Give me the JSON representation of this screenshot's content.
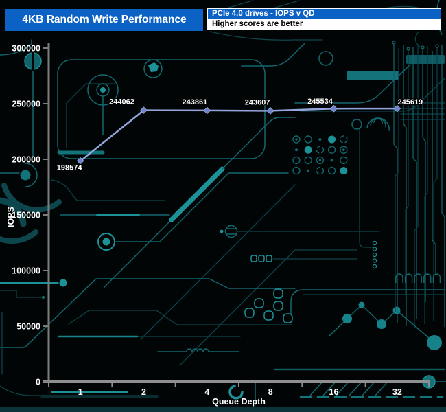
{
  "header": {
    "title": "4KB Random Write Performance",
    "subtitle": "PCIe 4.0 drives - IOPS v QD",
    "note": "Higher scores are better",
    "accent_color": "#0b61c4"
  },
  "chart_data": {
    "type": "line",
    "title": "4KB Random Write Performance",
    "categories": [
      "1",
      "2",
      "4",
      "8",
      "16",
      "32"
    ],
    "series": [
      {
        "name": "PCIe 4.0 drive",
        "values": [
          198574,
          244062,
          243861,
          243607,
          245534,
          245619
        ]
      }
    ],
    "point_labels": [
      "198574",
      "244062",
      "243861",
      "243607",
      "245534",
      "245619"
    ],
    "xlabel": "Queue Depth",
    "ylabel": "IOPS",
    "ylim": [
      0,
      300000
    ],
    "ytick_step": 50000,
    "yticks": [
      "300000",
      "250000",
      "200000",
      "150000",
      "100000",
      "50000",
      "0"
    ],
    "grid": false,
    "legend": "none",
    "line_color": "#93a5db",
    "marker_color": "#7082cc",
    "axis_color": "#8f8f8f",
    "label_color": "#ffffff",
    "background_style": "dark circuit board",
    "background_colors": {
      "bg": "#020505",
      "trace_dim": "#0c444a",
      "trace_mid": "#13676f",
      "trace_bright": "#1d9198"
    }
  }
}
